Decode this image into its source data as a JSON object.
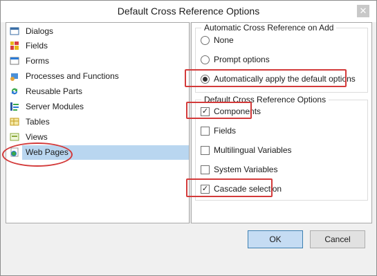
{
  "window": {
    "title": "Default Cross Reference Options",
    "close_glyph": "✕"
  },
  "tree": {
    "items": [
      {
        "label": "Dialogs",
        "icon": "dialog-icon"
      },
      {
        "label": "Fields",
        "icon": "fields-icon"
      },
      {
        "label": "Forms",
        "icon": "forms-icon"
      },
      {
        "label": "Processes and Functions",
        "icon": "processes-icon"
      },
      {
        "label": "Reusable Parts",
        "icon": "reusable-parts-icon"
      },
      {
        "label": "Server Modules",
        "icon": "server-modules-icon"
      },
      {
        "label": "Tables",
        "icon": "tables-icon"
      },
      {
        "label": "Views",
        "icon": "views-icon"
      },
      {
        "label": "Web Pages",
        "icon": "web-pages-icon",
        "selected": true
      }
    ]
  },
  "auto_group": {
    "title": "Automatic Cross Reference on Add",
    "options": [
      {
        "label": "None",
        "checked": false
      },
      {
        "label": "Prompt options",
        "checked": false
      },
      {
        "label": "Automatically apply the default options",
        "checked": true
      }
    ]
  },
  "default_group": {
    "title": "Default Cross Reference Options",
    "options": [
      {
        "label": "Components",
        "checked": true,
        "mark": "✓"
      },
      {
        "label": "Fields",
        "checked": false,
        "mark": ""
      },
      {
        "label": "Multilingual Variables",
        "checked": false,
        "mark": ""
      },
      {
        "label": "System Variables",
        "checked": false,
        "mark": ""
      },
      {
        "label": "Cascade selection",
        "checked": true,
        "mark": "✓"
      }
    ]
  },
  "buttons": {
    "ok": "OK",
    "cancel": "Cancel"
  },
  "colors": {
    "highlight": "#d33a3a",
    "selection": "#b9d6f0",
    "ok_button": "#c5dcf3"
  }
}
